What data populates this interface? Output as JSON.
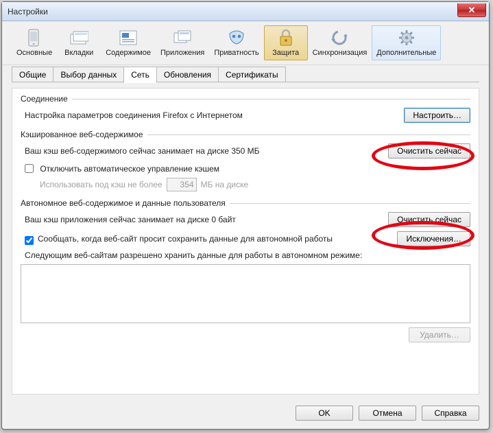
{
  "window": {
    "title": "Настройки"
  },
  "categories": [
    {
      "label": "Основные"
    },
    {
      "label": "Вкладки"
    },
    {
      "label": "Содержимое"
    },
    {
      "label": "Приложения"
    },
    {
      "label": "Приватность"
    },
    {
      "label": "Защита"
    },
    {
      "label": "Синхронизация"
    },
    {
      "label": "Дополнительные"
    }
  ],
  "sub_tabs": [
    {
      "label": "Общие"
    },
    {
      "label": "Выбор данных"
    },
    {
      "label": "Сеть"
    },
    {
      "label": "Обновления"
    },
    {
      "label": "Сертификаты"
    }
  ],
  "connection": {
    "title": "Соединение",
    "desc": "Настройка параметров соединения Firefox с Интернетом",
    "settings_btn": "Настроить…"
  },
  "cached": {
    "title": "Кэшированное веб-содержимое",
    "usage": "Ваш кэш веб-содержимого сейчас занимает на диске 350 МБ",
    "clear_btn": "Очистить сейчас",
    "override_checkbox": "Отключить автоматическое управление кэшем",
    "limit_prefix": "Использовать под кэш не более",
    "limit_value": "354",
    "limit_suffix": "МБ на диске"
  },
  "offline": {
    "title": "Автономное веб-содержимое и данные пользователя",
    "usage": "Ваш кэш приложения сейчас занимает на диске 0 байт",
    "clear_btn": "Очистить сейчас",
    "notify_checkbox": "Сообщать, когда веб-сайт просит сохранить данные для автономной работы",
    "exceptions_btn": "Исключения…",
    "list_label": "Следующим веб-сайтам разрешено хранить данные для работы в автономном режиме:",
    "remove_btn": "Удалить…"
  },
  "footer": {
    "ok": "OK",
    "cancel": "Отмена",
    "help": "Справка"
  }
}
